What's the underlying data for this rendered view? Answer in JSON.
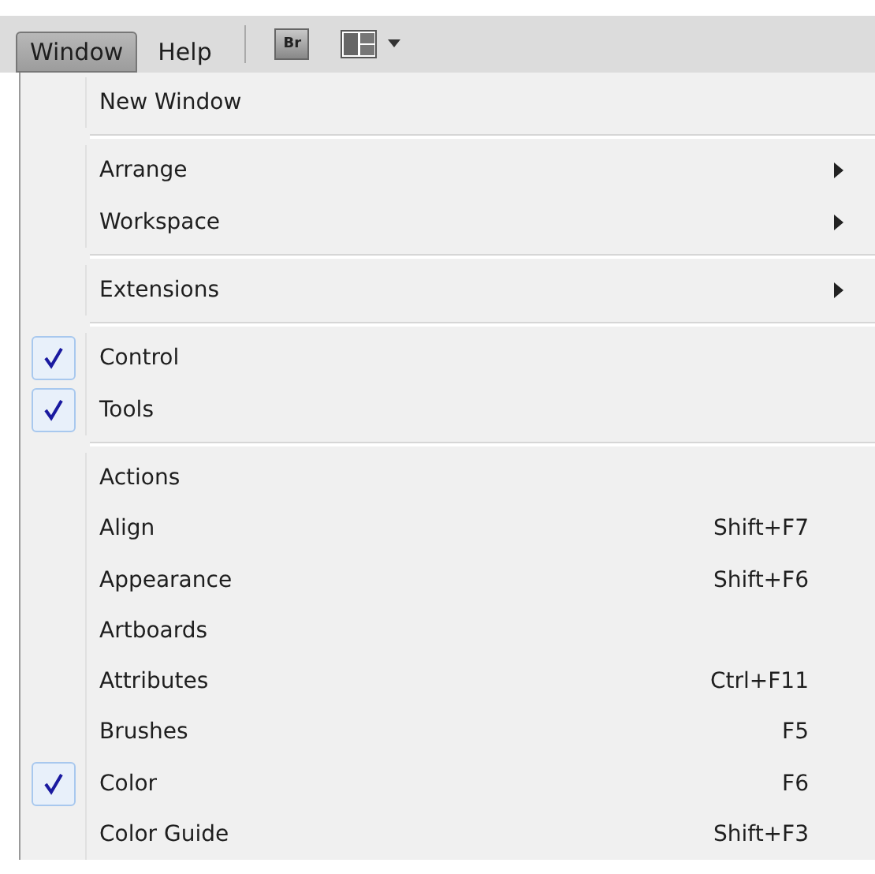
{
  "menubar": [
    {
      "label": "Window",
      "selected": true
    },
    {
      "label": "Help",
      "selected": false
    }
  ],
  "toolbar": {
    "bridge_label": "Br"
  },
  "menu": {
    "sections": [
      [
        {
          "label": "New Window",
          "checked": false,
          "submenu": false
        }
      ],
      [
        {
          "label": "Arrange",
          "checked": false,
          "submenu": true
        },
        {
          "label": "Workspace",
          "checked": false,
          "submenu": true
        }
      ],
      [
        {
          "label": "Extensions",
          "checked": false,
          "submenu": true
        }
      ],
      [
        {
          "label": "Control",
          "checked": true,
          "submenu": false
        },
        {
          "label": "Tools",
          "checked": true,
          "submenu": false
        }
      ],
      [
        {
          "label": "Actions",
          "checked": false,
          "submenu": false
        },
        {
          "label": "Align",
          "checked": false,
          "submenu": false,
          "shortcut": "Shift+F7"
        },
        {
          "label": "Appearance",
          "checked": false,
          "submenu": false,
          "shortcut": "Shift+F6"
        },
        {
          "label": "Artboards",
          "checked": false,
          "submenu": false
        },
        {
          "label": "Attributes",
          "checked": false,
          "submenu": false,
          "shortcut": "Ctrl+F11"
        },
        {
          "label": "Brushes",
          "checked": false,
          "submenu": false,
          "shortcut": "F5"
        },
        {
          "label": "Color",
          "checked": true,
          "submenu": false,
          "shortcut": "F6"
        },
        {
          "label": "Color Guide",
          "checked": false,
          "submenu": false,
          "shortcut": "Shift+F3"
        }
      ]
    ]
  }
}
